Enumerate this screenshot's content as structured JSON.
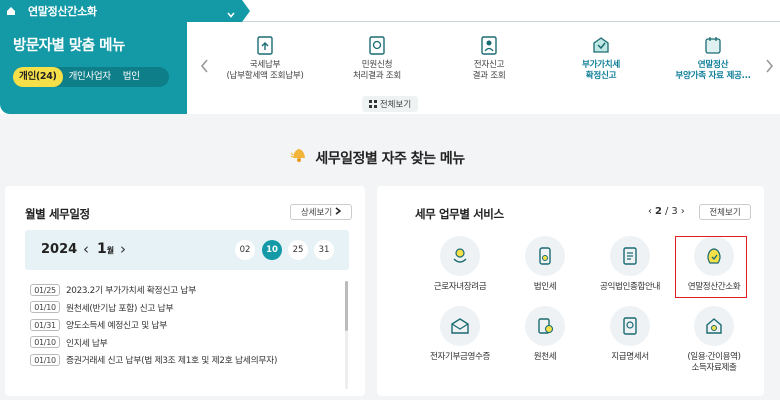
{
  "topbar": {
    "title": "연말정산간소화"
  },
  "visit_panel": {
    "title": "방문자별 맞춤 메뉴",
    "tabs": [
      {
        "label": "개인(24)",
        "active": true
      },
      {
        "label": "개인사업자",
        "active": false
      },
      {
        "label": "법인",
        "active": false
      }
    ]
  },
  "quick_menu": {
    "items": [
      {
        "label": "국세납부\n(납부할세액 조회납부)",
        "icon": "tax-payment-icon",
        "bold": false
      },
      {
        "label": "민원신청\n처리결과 조회",
        "icon": "civil-petition-icon",
        "bold": false
      },
      {
        "label": "전자신고\n결과 조회",
        "icon": "e-filing-icon",
        "bold": false
      },
      {
        "label": "부가가치세\n확정신고",
        "icon": "vat-icon",
        "bold": true
      },
      {
        "label": "연말정산\n부양가족 자료 제공...",
        "icon": "year-end-icon",
        "bold": true
      }
    ],
    "fullview_label": "전체보기"
  },
  "frequent": {
    "title": "세무일정별 자주 찾는 메뉴"
  },
  "schedule": {
    "title": "월별 세무일정",
    "detail_label": "상세보기",
    "year": "2024",
    "month": "1",
    "month_unit": "월",
    "days": [
      {
        "label": "02",
        "active": false
      },
      {
        "label": "10",
        "active": true
      },
      {
        "label": "25",
        "active": false
      },
      {
        "label": "31",
        "active": false
      }
    ],
    "rows": [
      {
        "date": "01/25",
        "text": "2023.2기 부가가치세 확정신고 납부"
      },
      {
        "date": "01/10",
        "text": "원천세(반기납 포함) 신고 납부"
      },
      {
        "date": "01/31",
        "text": "양도소득세 예정신고 및 납부"
      },
      {
        "date": "01/10",
        "text": "인지세 납부"
      },
      {
        "date": "01/10",
        "text": "증권거래세 신고 납부(법 제3조 제1호 및 제2호 납세의무자)"
      }
    ]
  },
  "services": {
    "title": "세무 업무별 서비스",
    "page_current": "2",
    "page_sep": "/",
    "page_total": "3",
    "fullview_label": "전체보기",
    "items": [
      {
        "label": "근로자녀장려금",
        "icon": "worker-incentive-icon"
      },
      {
        "label": "법인세",
        "icon": "corporate-tax-icon"
      },
      {
        "label": "공익법인종합안내",
        "icon": "public-corp-icon"
      },
      {
        "label": "연말정산간소화",
        "icon": "year-end-simple-icon"
      },
      {
        "label": "전자기부금영수증",
        "icon": "donation-receipt-icon"
      },
      {
        "label": "원천세",
        "icon": "withholding-tax-icon"
      },
      {
        "label": "지급명세서",
        "icon": "payment-statement-icon"
      },
      {
        "label": "(일용·간이용역)\n소득자료제출",
        "icon": "income-data-icon"
      }
    ]
  },
  "colors": {
    "teal": "#149aa6",
    "yellow": "#f6e04a",
    "highlight": "#e02020"
  }
}
